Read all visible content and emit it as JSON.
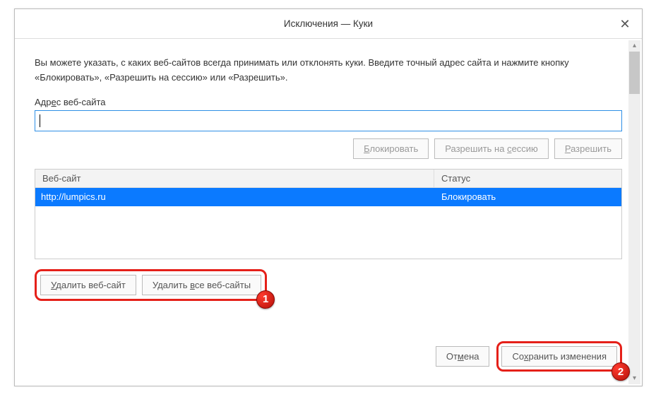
{
  "dialog": {
    "title": "Исключения — Куки",
    "description": "Вы можете указать, с каких веб-сайтов всегда принимать или отклонять куки. Введите точный адрес сайта и нажмите кнопку «Блокировать», «Разрешить на сессию» или «Разрешить».",
    "address_label_pre": "Адр",
    "address_label_underlined": "е",
    "address_label_post": "с веб-сайта",
    "address_value": "",
    "buttons": {
      "block_pre": "",
      "block_u": "Б",
      "block_post": "локировать",
      "session_pre": "Разрешить на ",
      "session_u": "с",
      "session_post": "ессию",
      "allow_pre": "",
      "allow_u": "Р",
      "allow_post": "азрешить"
    },
    "table": {
      "header_site": "Веб-сайт",
      "header_status": "Статус",
      "rows": [
        {
          "site": "http://lumpics.ru",
          "status": "Блокировать"
        }
      ]
    },
    "remove": {
      "remove_site_pre": "",
      "remove_site_u": "У",
      "remove_site_post": "далить веб-сайт",
      "remove_all_pre": "Удалить ",
      "remove_all_u": "в",
      "remove_all_post": "се веб-сайты"
    },
    "footer": {
      "cancel_pre": "От",
      "cancel_u": "м",
      "cancel_post": "ена",
      "save_pre": "Со",
      "save_u": "х",
      "save_post": "ранить изменения"
    },
    "annotations": {
      "badge1": "1",
      "badge2": "2"
    }
  }
}
